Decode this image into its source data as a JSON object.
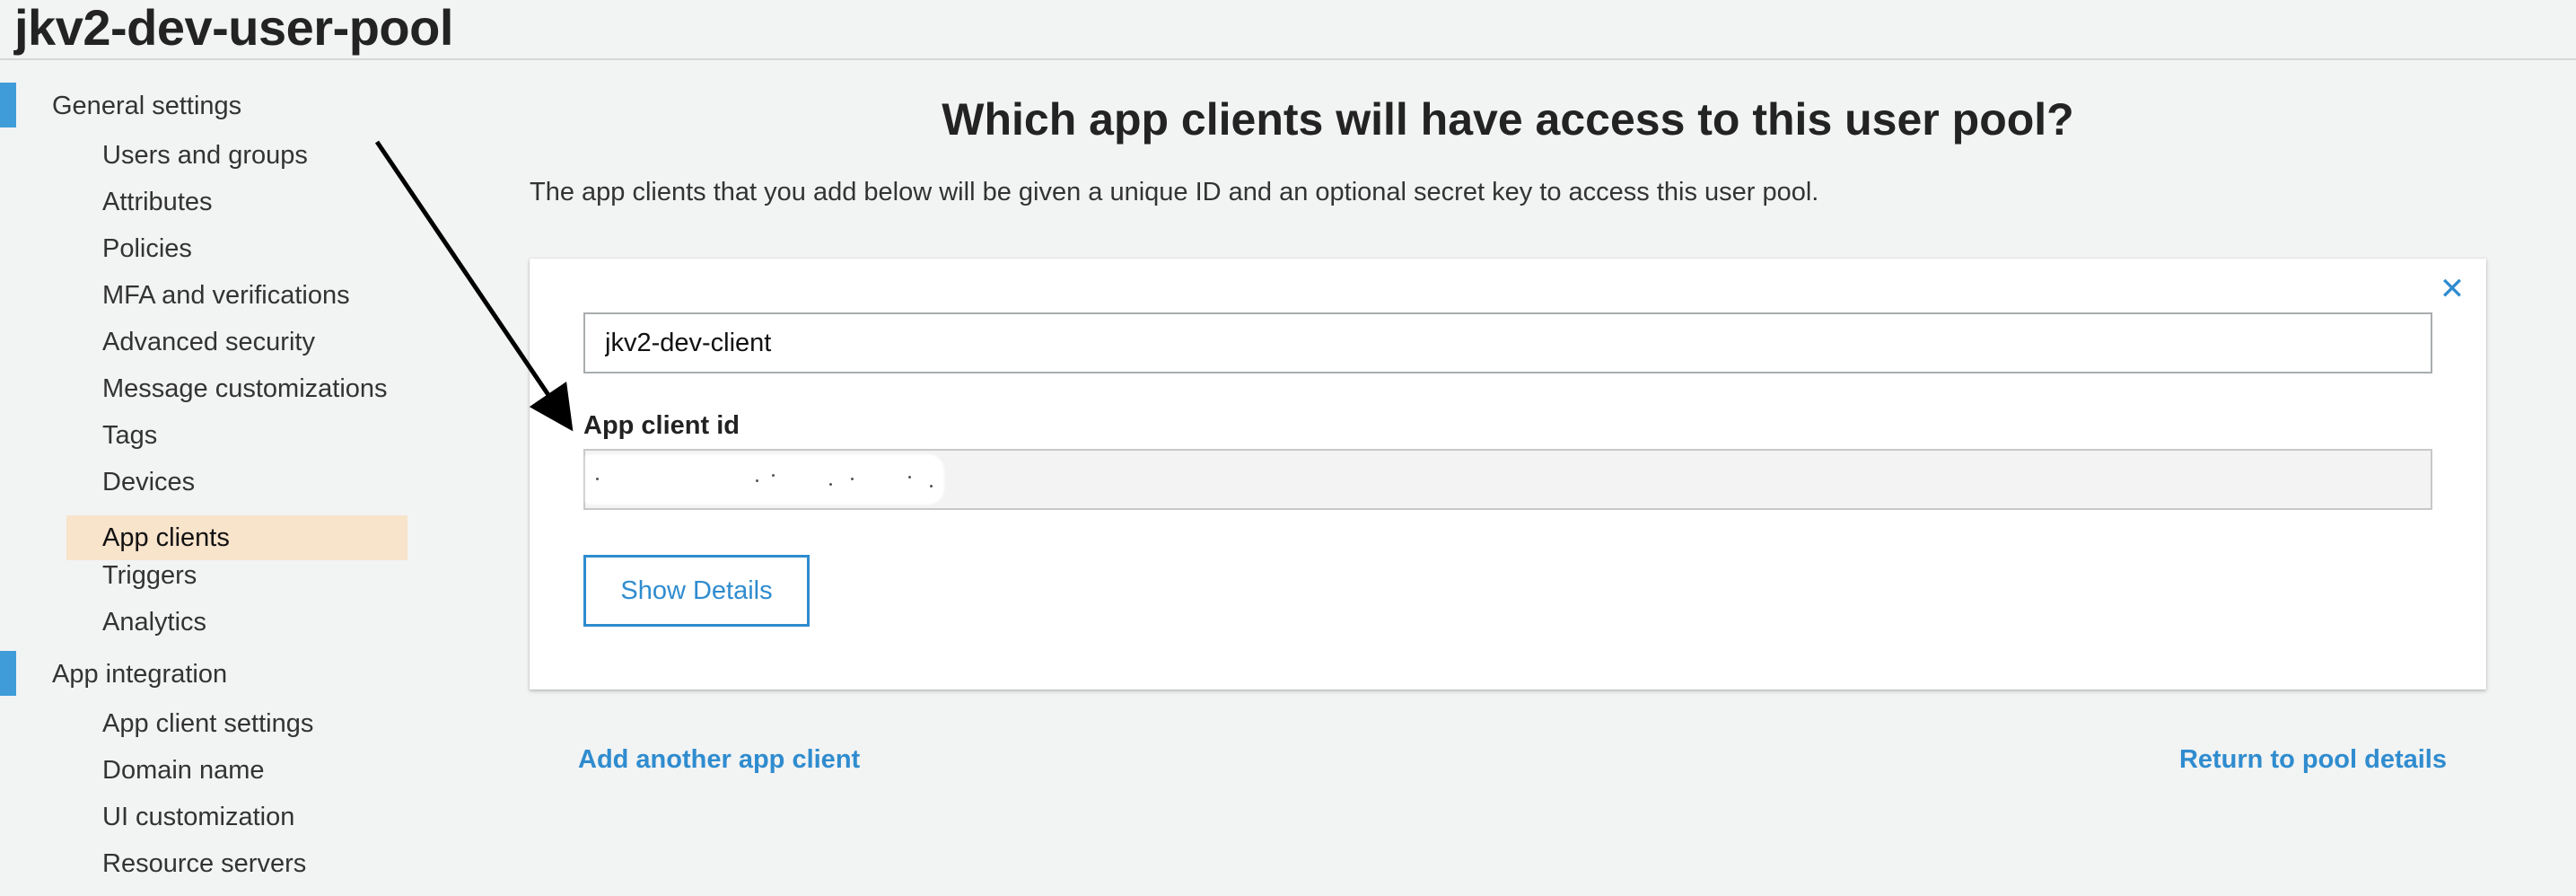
{
  "page": {
    "title": "jkv2-dev-user-pool"
  },
  "sidebar": {
    "sections": [
      {
        "label": "General settings",
        "items": [
          {
            "label": "Users and groups"
          },
          {
            "label": "Attributes"
          },
          {
            "label": "Policies"
          },
          {
            "label": "MFA and verifications"
          },
          {
            "label": "Advanced security"
          },
          {
            "label": "Message customizations"
          },
          {
            "label": "Tags"
          },
          {
            "label": "Devices"
          },
          {
            "label": "App clients",
            "active": true
          },
          {
            "label": "Triggers"
          },
          {
            "label": "Analytics"
          }
        ]
      },
      {
        "label": "App integration",
        "items": [
          {
            "label": "App client settings"
          },
          {
            "label": "Domain name"
          },
          {
            "label": "UI customization"
          },
          {
            "label": "Resource servers"
          }
        ]
      }
    ]
  },
  "main": {
    "heading": "Which app clients will have access to this user pool?",
    "description": "The app clients that you add below will be given a unique ID and an optional secret key to access this user pool.",
    "client": {
      "name_value": "jkv2-dev-client",
      "id_label": "App client id",
      "id_value": "",
      "show_details_label": "Show Details",
      "close_icon": "close-icon"
    },
    "add_another_label": "Add another app client",
    "return_label": "Return to pool details"
  },
  "colors": {
    "accent": "#2f8ccf",
    "section_marker": "#3f9cd8",
    "active_item_bg": "#f8e3cb",
    "page_bg": "#f2f3f3"
  }
}
